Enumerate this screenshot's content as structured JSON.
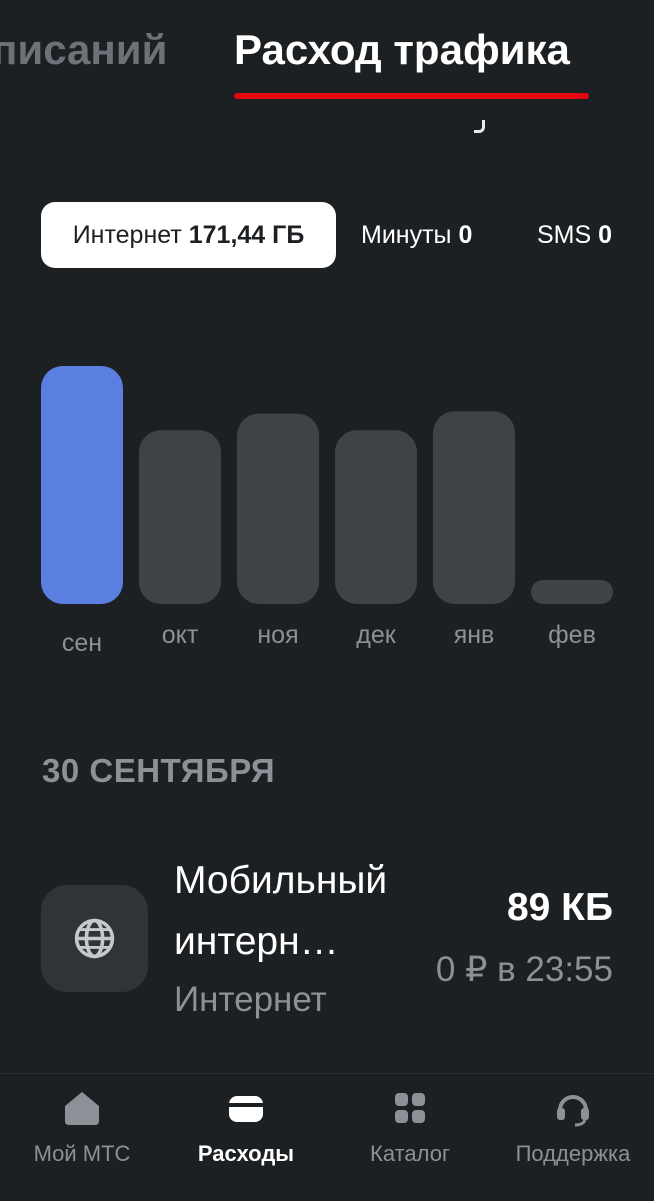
{
  "tabs": {
    "inactive_label": "писаний",
    "active_label": "Расход трафика"
  },
  "chips": {
    "internet": {
      "label": "Интернет",
      "value": "171,44 ГБ"
    },
    "minutes": {
      "label": "Минуты",
      "value": "0"
    },
    "sms": {
      "label": "SMS",
      "value": "0"
    }
  },
  "chart_data": {
    "type": "bar",
    "categories": [
      "сен",
      "окт",
      "ноя",
      "дек",
      "янв",
      "фев"
    ],
    "values": [
      100,
      73,
      80,
      73,
      81,
      10
    ],
    "selected_index": 0,
    "ylim": [
      0,
      100
    ],
    "colors": {
      "selected": "#5b7fe0",
      "default": "#3f4347"
    }
  },
  "date_header": "30 СЕНТЯБРЯ",
  "transaction": {
    "icon": "globe-icon",
    "title": "Мобильный интерн…",
    "category": "Интернет",
    "amount": "89 КБ",
    "time": "0 ₽ в 23:55"
  },
  "bottom_nav": [
    {
      "label": "Мой МТС",
      "icon": "home-icon"
    },
    {
      "label": "Расходы",
      "icon": "wallet-icon"
    },
    {
      "label": "Каталог",
      "icon": "grid-icon"
    },
    {
      "label": "Поддержка",
      "icon": "headset-icon"
    }
  ],
  "colors": {
    "accent": "#e30611",
    "background": "#1d2023",
    "muted": "#8c9197"
  }
}
